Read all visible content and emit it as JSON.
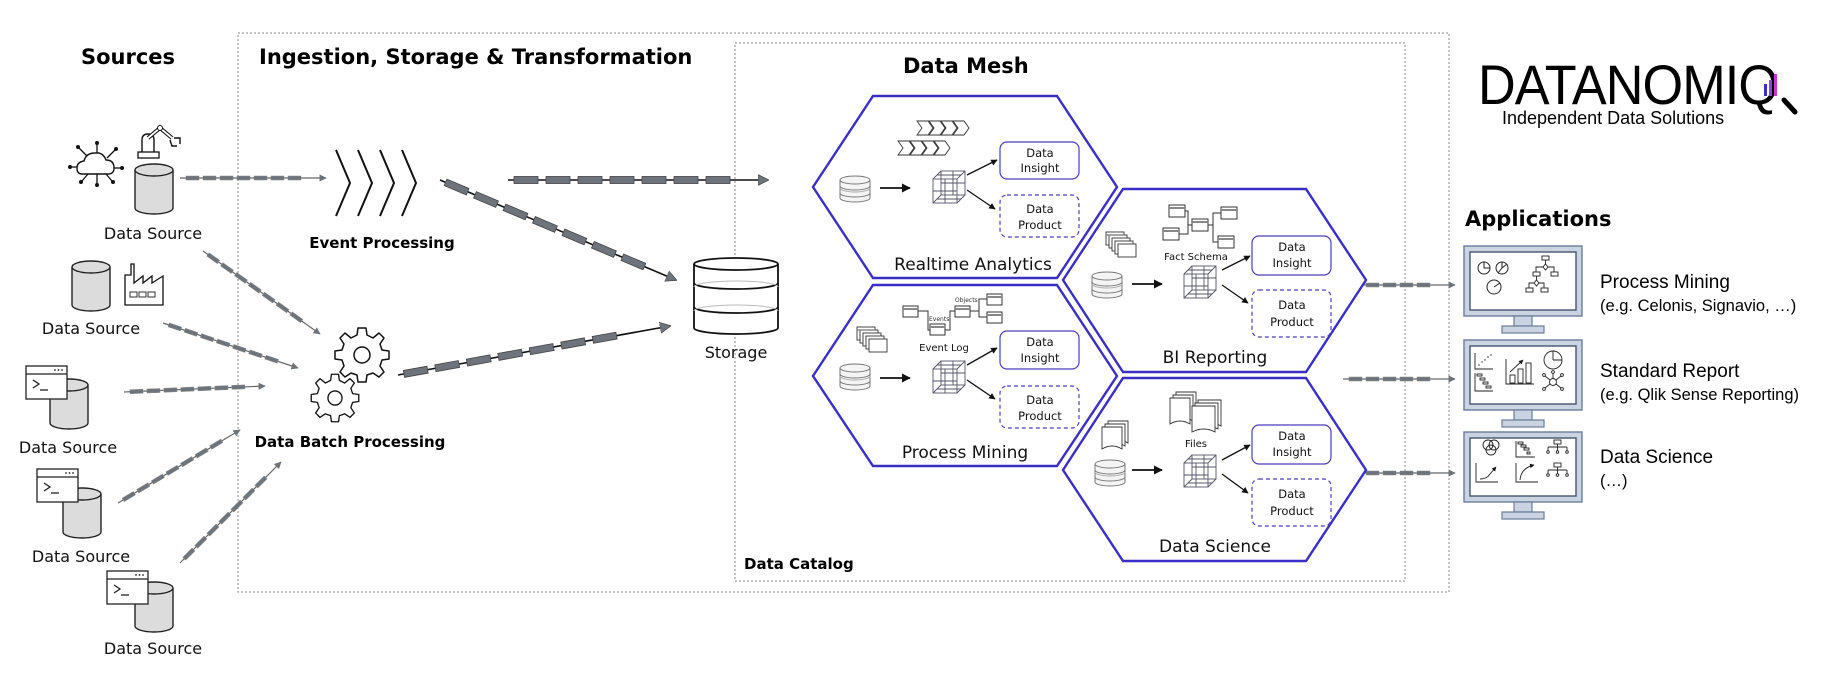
{
  "headings": {
    "sources": "Sources",
    "ingestion": "Ingestion, Storage & Transformation",
    "data_mesh": "Data Mesh",
    "data_catalog": "Data Catalog",
    "applications": "Applications"
  },
  "logo": {
    "name": "DATANOMIQ",
    "tagline": "Independent Data Solutions",
    "bar_colors": [
      "#3a2fc4",
      "#7a4fd8",
      "#c43ad6"
    ]
  },
  "sources": [
    {
      "label": "Data Source",
      "icons": [
        "iot-cloud-icon",
        "robot-arm-icon",
        "database-icon"
      ]
    },
    {
      "label": "Data Source",
      "icons": [
        "database-icon",
        "factory-icon"
      ]
    },
    {
      "label": "Data Source",
      "icons": [
        "terminal-window-icon",
        "database-icon"
      ]
    },
    {
      "label": "Data Source",
      "icons": [
        "terminal-window-icon",
        "database-icon"
      ]
    },
    {
      "label": "Data Source",
      "icons": [
        "terminal-window-icon",
        "database-icon"
      ]
    }
  ],
  "processing": {
    "event": "Event Processing",
    "batch": "Data Batch Processing",
    "storage": "Storage"
  },
  "domains": [
    {
      "title": "Realtime Analytics",
      "artifact": "",
      "insight": "Data Insight",
      "product": "Data Product"
    },
    {
      "title": "Process Mining",
      "artifact": "Event Log",
      "insight": "Data Insight",
      "product": "Data Product",
      "sub_labels": [
        "Events",
        "Objects"
      ]
    },
    {
      "title": "BI Reporting",
      "artifact": "Fact Schema",
      "insight": "Data Insight",
      "product": "Data Product"
    },
    {
      "title": "Data Science",
      "artifact": "Files",
      "insight": "Data Insight",
      "product": "Data Product"
    }
  ],
  "box_words": {
    "insight_1": "Data",
    "insight_2": "Insight",
    "product_1": "Data",
    "product_2": "Product"
  },
  "applications": [
    {
      "title": "Process Mining",
      "subtitle": "(e.g. Celonis, Signavio, …)"
    },
    {
      "title": "Standard Report",
      "subtitle": "(e.g. Qlik Sense Reporting)"
    },
    {
      "title": "Data Science",
      "subtitle": "(…)"
    }
  ],
  "colors": {
    "hex_border": "#3a2fc4",
    "pipe_fill": "#6e747c",
    "cylinder_fill": "#dcdcdc"
  }
}
